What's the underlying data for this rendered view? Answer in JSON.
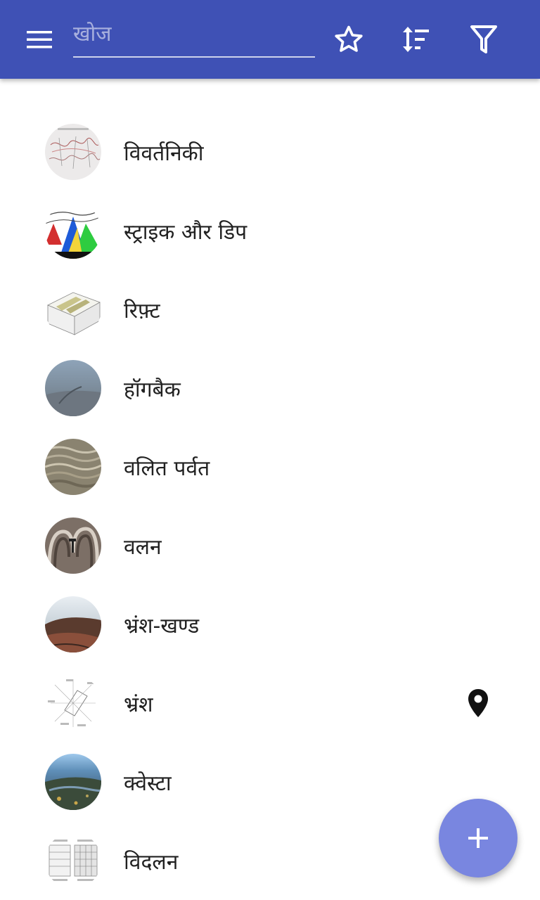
{
  "appbar": {
    "background": "#3f51b5",
    "search_placeholder": "खोज",
    "icons": [
      "menu-icon",
      "star-icon",
      "sort-icon",
      "filter-icon"
    ]
  },
  "items": [
    {
      "label": "विवर्तनिकी",
      "thumbnail": "map-thumbnail"
    },
    {
      "label": "स्ट्राइक और डिप",
      "thumbnail": "striped-diagram-thumbnail"
    },
    {
      "label": "रिफ़्ट",
      "thumbnail": "block-diagram-thumbnail"
    },
    {
      "label": "हॉगबैक",
      "thumbnail": "landscape-photo-thumbnail"
    },
    {
      "label": "वलित पर्वत",
      "thumbnail": "folded-terrain-photo-thumbnail"
    },
    {
      "label": "वलन",
      "thumbnail": "rock-fold-photo-thumbnail"
    },
    {
      "label": "भ्रंश-खण्ड",
      "thumbnail": "hillside-photo-thumbnail"
    },
    {
      "label": "भ्रंश",
      "thumbnail": "fault-diagram-thumbnail",
      "trailing_icon": "location-pin-icon"
    },
    {
      "label": "क्वेस्टा",
      "thumbnail": "aerial-photo-thumbnail"
    },
    {
      "label": "विदलन",
      "thumbnail": "rock-layers-diagram-thumbnail"
    }
  ],
  "fab": {
    "icon": "plus-icon",
    "color": "#7986e0"
  }
}
